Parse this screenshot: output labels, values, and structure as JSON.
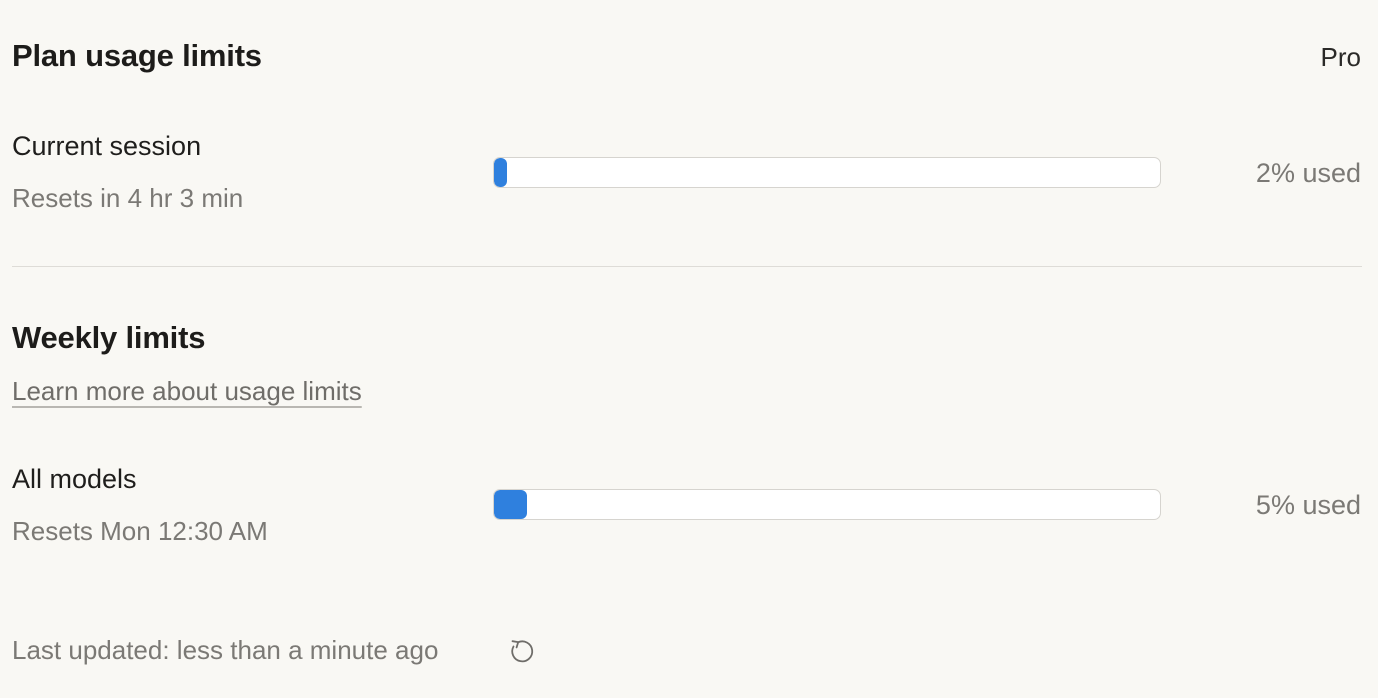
{
  "header": {
    "title": "Plan usage limits",
    "plan": "Pro"
  },
  "session": {
    "label": "Current session",
    "resets": "Resets in 4 hr 3 min",
    "used_text": "2% used",
    "used_percent": 2
  },
  "weekly": {
    "title": "Weekly limits",
    "learn_more": "Learn more about usage limits",
    "models": {
      "label": "All models",
      "resets": "Resets Mon 12:30 AM",
      "used_text": "5% used",
      "used_percent": 5
    }
  },
  "footer": {
    "last_updated": "Last updated: less than a minute ago",
    "refresh_icon": "refresh-icon"
  },
  "colors": {
    "background": "#f9f8f4",
    "accent": "#2f80de",
    "muted_text": "#7b7975"
  }
}
